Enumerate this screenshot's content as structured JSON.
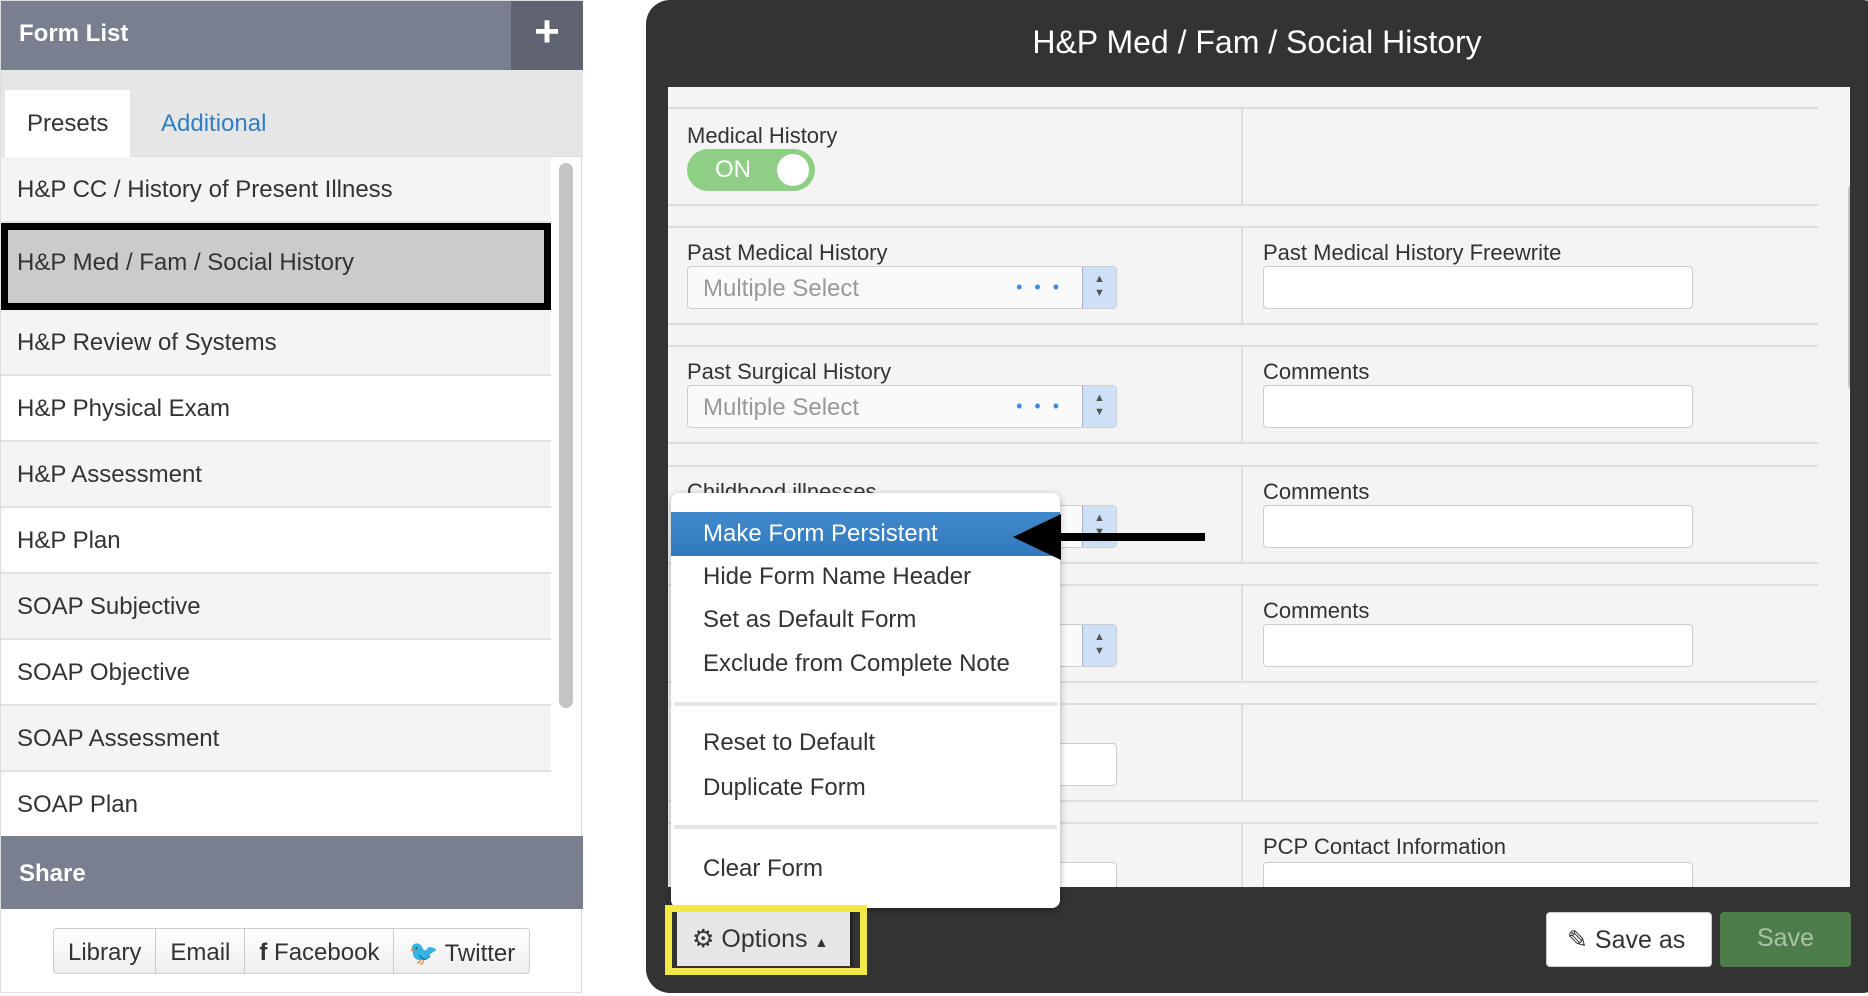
{
  "sidebar": {
    "title": "Form List",
    "add_icon": "plus-icon",
    "tabs": [
      "Presets",
      "Additional"
    ],
    "items": [
      "H&P CC / History of Present Illness",
      "H&P Med / Fam / Social History",
      "H&P Review of Systems",
      "H&P Physical Exam",
      "H&P Assessment",
      "H&P Plan",
      "SOAP Subjective",
      "SOAP Objective",
      "SOAP Assessment",
      "SOAP Plan"
    ],
    "selected": "H&P Med / Fam / Social History"
  },
  "share": {
    "title": "Share",
    "buttons": [
      "Library",
      "Email",
      "Facebook",
      "Twitter"
    ]
  },
  "form": {
    "title": "H&P Med / Fam / Social History",
    "medical_history": {
      "label": "Medical History",
      "toggle": "ON"
    },
    "fields": {
      "pmh": "Past Medical History",
      "pmh_placeholder": "Multiple Select",
      "pmh_free": "Past Medical History Freewrite",
      "psh": "Past Surgical History",
      "psh_placeholder": "Multiple Select",
      "comments": "Comments",
      "childhood": "Childhood illnesses",
      "pcp": "PCP Contact Information"
    }
  },
  "menu": {
    "items": [
      "Make Form Persistent",
      "Hide Form Name Header",
      "Set as Default Form",
      "Exclude from Complete Note",
      "Reset to Default",
      "Duplicate Form",
      "Clear Form"
    ],
    "highlighted": "Make Form Persistent"
  },
  "footer": {
    "options": "Options",
    "save_as": "Save as",
    "save": "Save"
  },
  "colors": {
    "highlight": "#3a82c4",
    "annotation_box": "#f3e84a",
    "toggle_on": "#8fcf85",
    "save": "#4e7d4c"
  }
}
